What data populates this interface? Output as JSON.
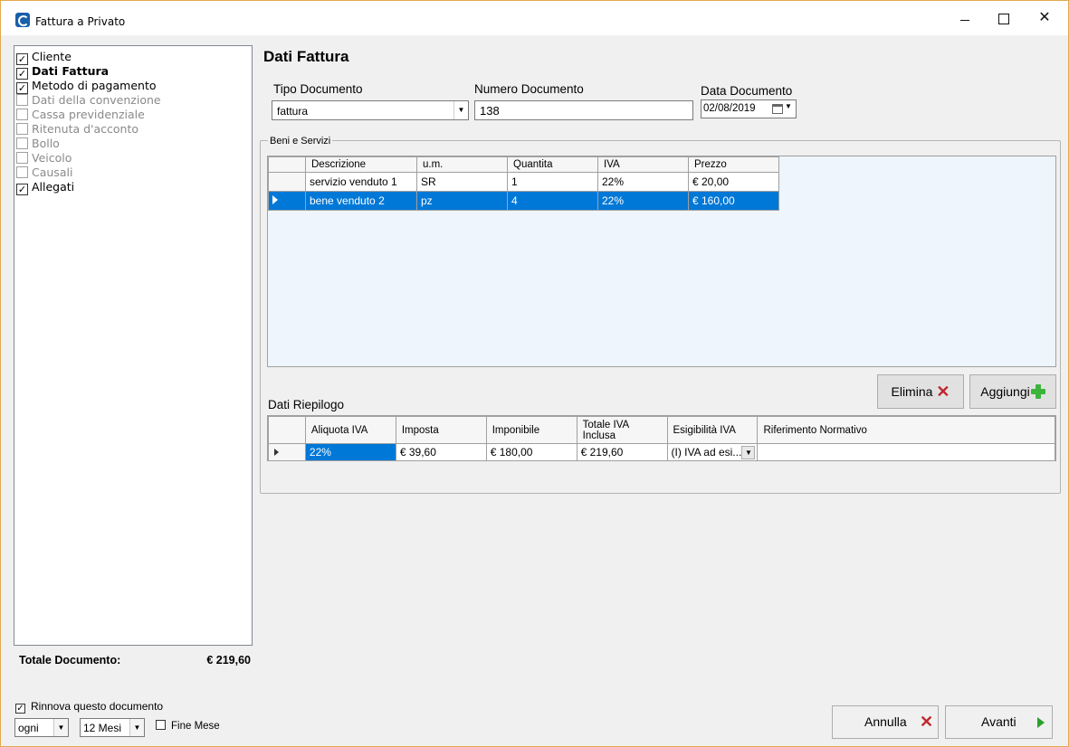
{
  "window": {
    "title": "Fattura a Privato",
    "close_glyph": "✕"
  },
  "nav": {
    "items": [
      {
        "label": "Cliente",
        "checked": true,
        "enabled": true,
        "bold": false
      },
      {
        "label": "Dati Fattura",
        "checked": true,
        "enabled": true,
        "bold": true
      },
      {
        "label": "Metodo di pagamento",
        "checked": true,
        "enabled": true,
        "bold": false
      },
      {
        "label": "Dati della convenzione",
        "checked": false,
        "enabled": false,
        "bold": false
      },
      {
        "label": "Cassa previdenziale",
        "checked": false,
        "enabled": false,
        "bold": false
      },
      {
        "label": "Ritenuta d'acconto",
        "checked": false,
        "enabled": false,
        "bold": false
      },
      {
        "label": "Bollo",
        "checked": false,
        "enabled": false,
        "bold": false
      },
      {
        "label": "Veicolo",
        "checked": false,
        "enabled": false,
        "bold": false
      },
      {
        "label": "Causali",
        "checked": false,
        "enabled": false,
        "bold": false
      },
      {
        "label": "Allegati",
        "checked": true,
        "enabled": true,
        "bold": false
      }
    ]
  },
  "totals": {
    "label": "Totale Documento:",
    "value": "€ 219,60"
  },
  "renew": {
    "label": "Rinnova questo documento",
    "checked": true,
    "frequency": "ogni",
    "period": "12 Mesi",
    "end_of_month_label": "Fine Mese",
    "end_of_month_checked": false
  },
  "main": {
    "title": "Dati Fattura",
    "tipo_documento": {
      "label": "Tipo Documento",
      "value": "fattura"
    },
    "numero_documento": {
      "label": "Numero Documento",
      "value": "138"
    },
    "data_documento": {
      "label": "Data Documento",
      "value": "02/08/2019"
    },
    "beni_servizi": {
      "legend": "Beni e Servizi",
      "columns": [
        "Descrizione",
        "u.m.",
        "Quantita",
        "IVA",
        "Prezzo"
      ],
      "rows": [
        {
          "descrizione": "servizio venduto 1",
          "um": "SR",
          "quantita": "1",
          "iva": "22%",
          "prezzo": "€ 20,00",
          "selected": false
        },
        {
          "descrizione": "bene venduto 2",
          "um": "pz",
          "quantita": "4",
          "iva": "22%",
          "prezzo": "€ 160,00",
          "selected": true
        }
      ]
    },
    "buttons": {
      "elimina": "Elimina",
      "aggiungi": "Aggiungi"
    },
    "riepilogo": {
      "label": "Dati Riepilogo",
      "columns": [
        "Aliquota IVA",
        "Imposta",
        "Imponibile",
        "Totale IVA Inclusa",
        "Esigibilità IVA",
        "Riferimento Normativo"
      ],
      "rows": [
        {
          "aliquota": "22%",
          "imposta": "€ 39,60",
          "imponibile": "€ 180,00",
          "totale": "€ 219,60",
          "esigibilita": "(I) IVA ad esi...",
          "riferimento": ""
        }
      ]
    }
  },
  "footer": {
    "annulla": "Annulla",
    "avanti": "Avanti"
  },
  "colors": {
    "selection": "#0078d7",
    "window_border": "#e3a94f",
    "delete_icon": "#c0282d",
    "add_icon": "#3cb43c"
  }
}
